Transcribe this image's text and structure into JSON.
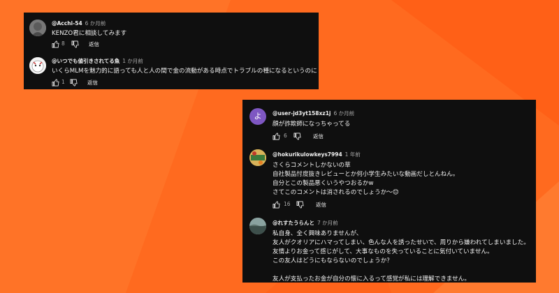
{
  "colors": {
    "background": "#ff6a1f",
    "panel": "#0f0f0f",
    "text": "#f1f1f1",
    "muted": "#aaaaaa",
    "avatar_purple": "#7e57c2"
  },
  "top_panel": {
    "comments": [
      {
        "handle": "@Acchi-54",
        "time": "6 か月前",
        "lines": [
          "KENZO君に相談してみます"
        ],
        "likes": "8",
        "reply": "返信"
      },
      {
        "handle": "@いつでも値引きされてる魚",
        "time": "1 か月前",
        "lines": [
          "いくらMLMを魅力的に語っても人と人の間で金の流動がある時点でトラブルの種になるというのに"
        ],
        "likes": "1",
        "reply": "返信"
      }
    ]
  },
  "bottom_panel": {
    "comments": [
      {
        "handle": "@user-jd3yt158xz1j",
        "time": "6 か月前",
        "avatar_letter": "よ",
        "lines": [
          "顔が詐欺師になっちゃってる"
        ],
        "likes": "6",
        "reply": "返信"
      },
      {
        "handle": "@hokurikulowkeys7994",
        "time": "1 年前",
        "lines": [
          "さくらコメントしかないの草",
          "自社製品忖度抜きレビューとか何小学生みたいな動画だしとんねん。",
          "自分とこの製品悪くいうやつおるかw",
          "さてこのコメントは消されるのでしょうか〜😊"
        ],
        "likes": "16",
        "reply": "返信"
      },
      {
        "handle": "@れすたうらんと",
        "time": "7 か月前",
        "lines": [
          "私自身、全く興味ありませんが、",
          "友人がクオリアにハマってしまい、色んな人を誘ったせいで、周りから嫌われてしまいました。",
          "友情よりお金って感じがして、大事なものを失っていることに気付いていません。",
          "この友人はどうにもならないのでしょうか？",
          "",
          "友人が支払ったお金が自分の懐に入るって感覚が私には理解できません。"
        ]
      }
    ]
  }
}
